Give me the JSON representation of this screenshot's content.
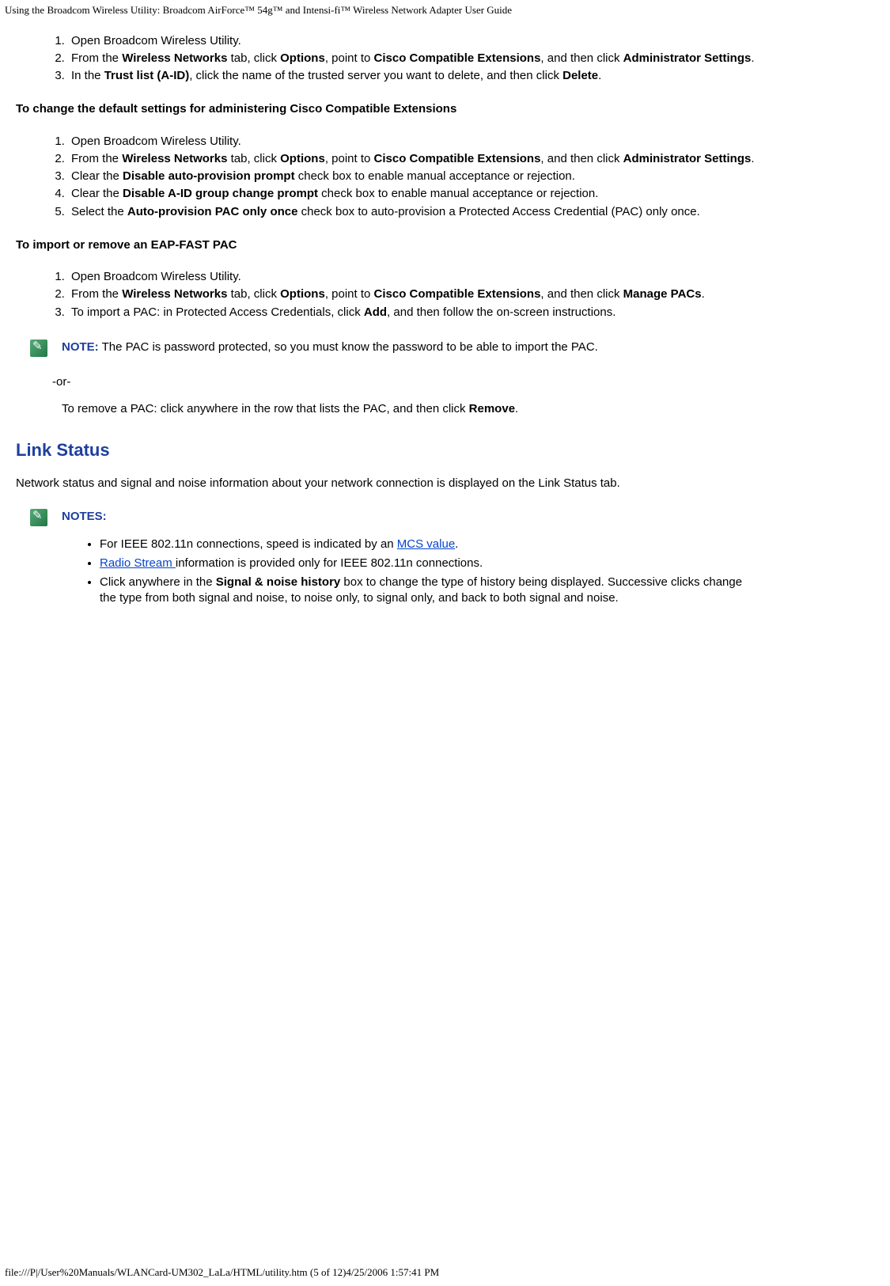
{
  "header": "Using the Broadcom Wireless Utility: Broadcom AirForce™ 54g™ and Intensi-fi™ Wireless Network Adapter User Guide",
  "footer": "file:///P|/User%20Manuals/WLANCard-UM302_LaLa/HTML/utility.htm (5 of 12)4/25/2006 1:57:41 PM",
  "list1": {
    "i1": "Open Broadcom Wireless Utility.",
    "i2a": "From the ",
    "i2b": "Wireless Networks",
    "i2c": " tab, click ",
    "i2d": "Options",
    "i2e": ", point to ",
    "i2f": "Cisco Compatible Extensions",
    "i2g": ", and then click ",
    "i2h": "Administrator Settings",
    "i2i": ".",
    "i3a": "In the ",
    "i3b": "Trust list (A-ID)",
    "i3c": ", click the name of the trusted server you want to delete, and then click ",
    "i3d": "Delete",
    "i3e": "."
  },
  "heading2": "To change the default settings for administering Cisco Compatible Extensions",
  "list2": {
    "i1": "Open Broadcom Wireless Utility.",
    "i2a": "From the ",
    "i2b": "Wireless Networks",
    "i2c": " tab, click ",
    "i2d": "Options",
    "i2e": ", point to ",
    "i2f": "Cisco Compatible Extensions",
    "i2g": ", and then click ",
    "i2h": "Administrator Settings",
    "i2i": ".",
    "i3a": "Clear the ",
    "i3b": "Disable auto-provision prompt",
    "i3c": " check box to enable manual acceptance or rejection.",
    "i4a": "Clear the ",
    "i4b": "Disable A-ID group change prompt",
    "i4c": " check box to enable manual acceptance or rejection.",
    "i5a": "Select the ",
    "i5b": "Auto-provision PAC only once",
    "i5c": " check box to auto-provision a Protected Access Credential (PAC) only once."
  },
  "heading3": "To import or remove an EAP-FAST PAC",
  "list3": {
    "i1": "Open Broadcom Wireless Utility.",
    "i2a": "From the ",
    "i2b": "Wireless Networks",
    "i2c": " tab, click ",
    "i2d": "Options",
    "i2e": ", point to ",
    "i2f": "Cisco Compatible Extensions",
    "i2g": ", and then click ",
    "i2h": "Manage PACs",
    "i2i": ".",
    "i3a": "To import a PAC: in Protected Access Credentials, click ",
    "i3b": "Add",
    "i3c": ", and then follow the on-screen instructions."
  },
  "note1": {
    "label": "NOTE:",
    "text": " The PAC is password protected, so you must know the password to be able to import the PAC."
  },
  "or": "-or-",
  "removeA": "To remove a PAC: click anywhere in the row that lists the PAC, and then click ",
  "removeB": "Remove",
  "removeC": ".",
  "h2": "Link Status",
  "linkPara": "Network status and signal and noise information about your network connection is displayed on the Link Status tab.",
  "notesLabel": "NOTES:",
  "notes": {
    "n1a": "For IEEE 802.11n connections, speed is indicated by an ",
    "n1b": "MCS value",
    "n1c": ".",
    "n2a": "Radio Stream ",
    "n2b": "information is provided only for IEEE 802.11n connections.",
    "n3a": "Click anywhere in the ",
    "n3b": "Signal & noise history",
    "n3c": " box to change the type of history being displayed. Successive clicks change the type from both signal and noise, to noise only, to signal only, and back to both signal and noise."
  }
}
